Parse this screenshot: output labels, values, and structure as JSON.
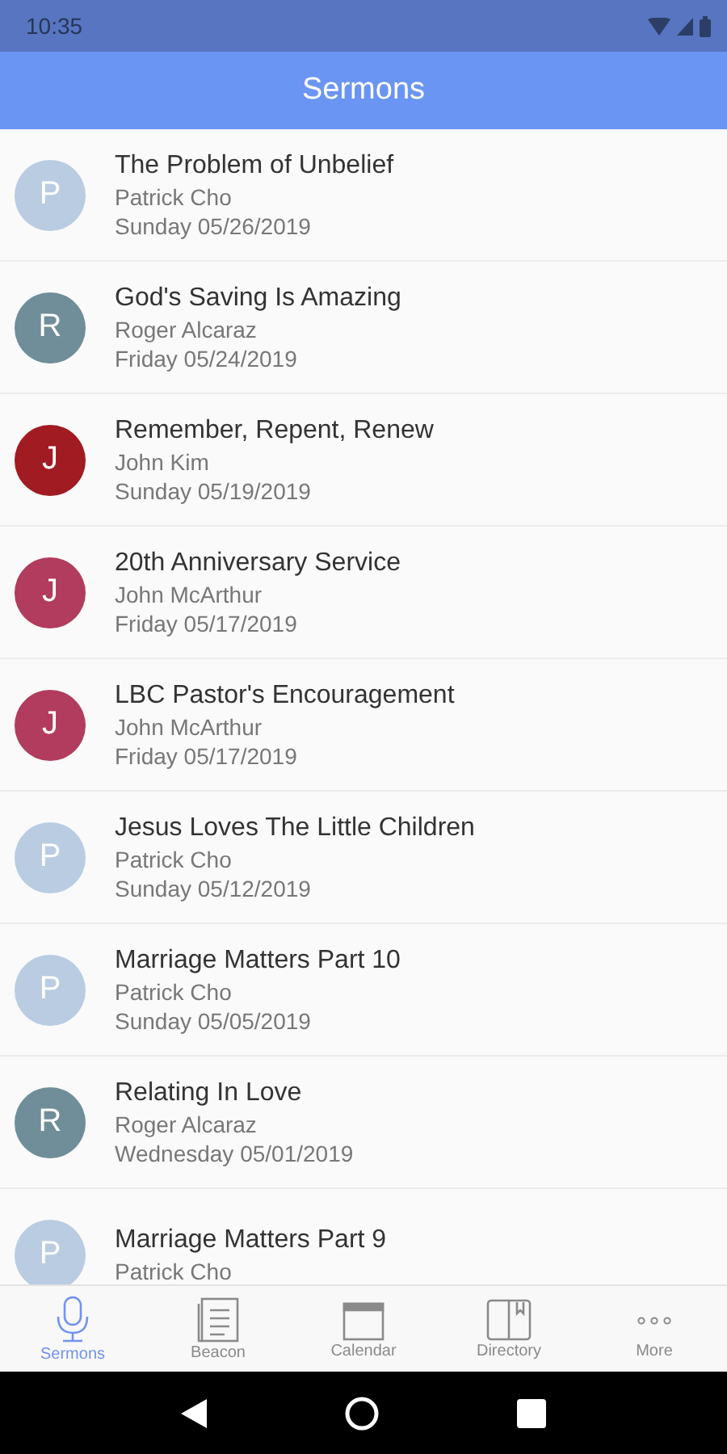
{
  "status_bar": {
    "time": "10:35"
  },
  "header": {
    "title": "Sermons"
  },
  "sermons": [
    {
      "initial": "P",
      "color": "#b9cce2",
      "title": "The Problem of Unbelief",
      "speaker": "Patrick Cho",
      "date": "Sunday 05/26/2019"
    },
    {
      "initial": "R",
      "color": "#6f8e99",
      "title": "God's Saving Is Amazing",
      "speaker": "Roger Alcaraz",
      "date": "Friday 05/24/2019"
    },
    {
      "initial": "J",
      "color": "#a01b22",
      "title": "Remember, Repent, Renew",
      "speaker": "John Kim",
      "date": "Sunday 05/19/2019"
    },
    {
      "initial": "J",
      "color": "#b13c5e",
      "title": "20th Anniversary Service",
      "speaker": "John McArthur",
      "date": "Friday 05/17/2019"
    },
    {
      "initial": "J",
      "color": "#b13c5e",
      "title": "LBC Pastor's Encouragement",
      "speaker": "John McArthur",
      "date": "Friday 05/17/2019"
    },
    {
      "initial": "P",
      "color": "#b9cce2",
      "title": "Jesus Loves The Little Children",
      "speaker": "Patrick Cho",
      "date": "Sunday 05/12/2019"
    },
    {
      "initial": "P",
      "color": "#b9cce2",
      "title": "Marriage Matters Part 10",
      "speaker": "Patrick Cho",
      "date": "Sunday 05/05/2019"
    },
    {
      "initial": "R",
      "color": "#6f8e99",
      "title": "Relating In Love",
      "speaker": "Roger Alcaraz",
      "date": "Wednesday 05/01/2019"
    },
    {
      "initial": "P",
      "color": "#b9cce2",
      "title": "Marriage Matters Part 9",
      "speaker": "Patrick Cho"
    }
  ],
  "tabs": [
    {
      "kind": "mic",
      "label": "Sermons",
      "selected": true
    },
    {
      "kind": "document",
      "label": "Beacon",
      "selected": false
    },
    {
      "kind": "calendar",
      "label": "Calendar",
      "selected": false
    },
    {
      "kind": "book",
      "label": "Directory",
      "selected": false
    },
    {
      "kind": "dots",
      "label": "More",
      "selected": false
    }
  ]
}
